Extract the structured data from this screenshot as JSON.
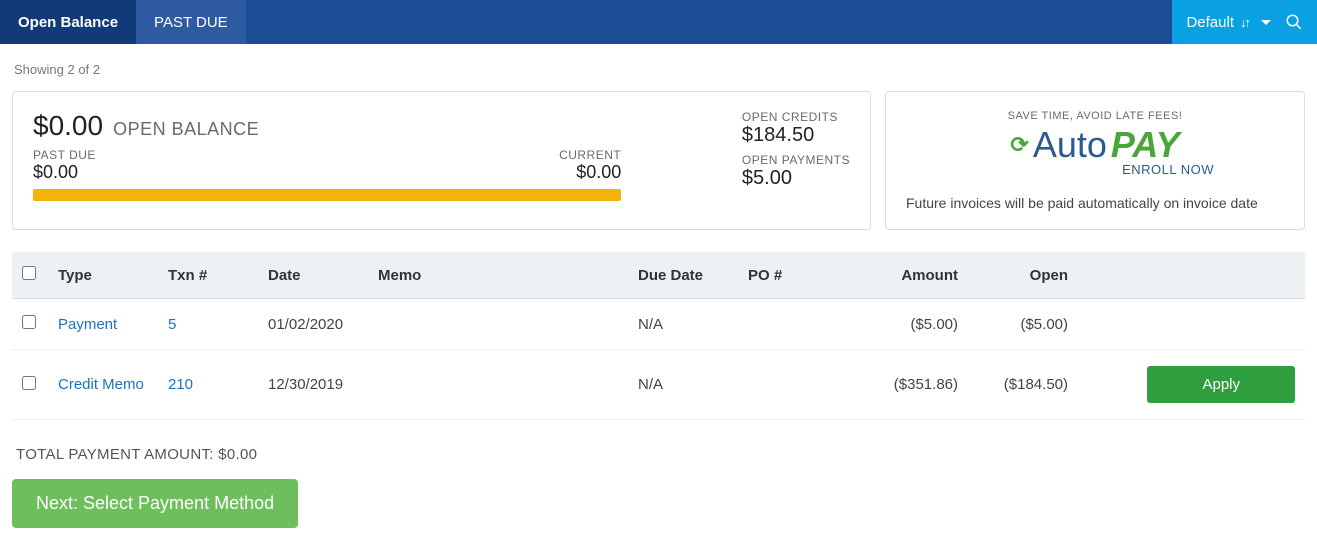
{
  "nav": {
    "tab_open_balance": "Open Balance",
    "tab_past_due": "PAST DUE",
    "sort_label": "Default"
  },
  "showing_text": "Showing 2 of 2",
  "balance": {
    "open_balance_amount": "$0.00",
    "open_balance_label": "OPEN BALANCE",
    "past_due_label": "PAST DUE",
    "past_due_amount": "$0.00",
    "current_label": "CURRENT",
    "current_amount": "$0.00",
    "open_credits_label": "OPEN CREDITS",
    "open_credits_amount": "$184.50",
    "open_payments_label": "OPEN PAYMENTS",
    "open_payments_amount": "$5.00"
  },
  "autopay": {
    "tagline": "SAVE TIME, AVOID LATE FEES!",
    "auto_text": "Auto",
    "pay_text": "PAY",
    "enroll": "ENROLL NOW",
    "description": "Future invoices will be paid automatically on invoice date"
  },
  "table": {
    "headers": {
      "type": "Type",
      "txn": "Txn #",
      "date": "Date",
      "memo": "Memo",
      "due": "Due Date",
      "po": "PO #",
      "amount": "Amount",
      "open": "Open"
    },
    "rows": [
      {
        "type": "Payment",
        "txn": "5",
        "date": "01/02/2020",
        "memo": "",
        "due": "N/A",
        "po": "",
        "amount": "($5.00)",
        "open": "($5.00)",
        "apply": false
      },
      {
        "type": "Credit Memo",
        "txn": "210",
        "date": "12/30/2019",
        "memo": "",
        "due": "N/A",
        "po": "",
        "amount": "($351.86)",
        "open": "($184.50)",
        "apply": true
      }
    ]
  },
  "total_label": "TOTAL PAYMENT AMOUNT: ",
  "total_value": "$0.00",
  "apply_label": "Apply",
  "next_button": "Next: Select Payment Method"
}
